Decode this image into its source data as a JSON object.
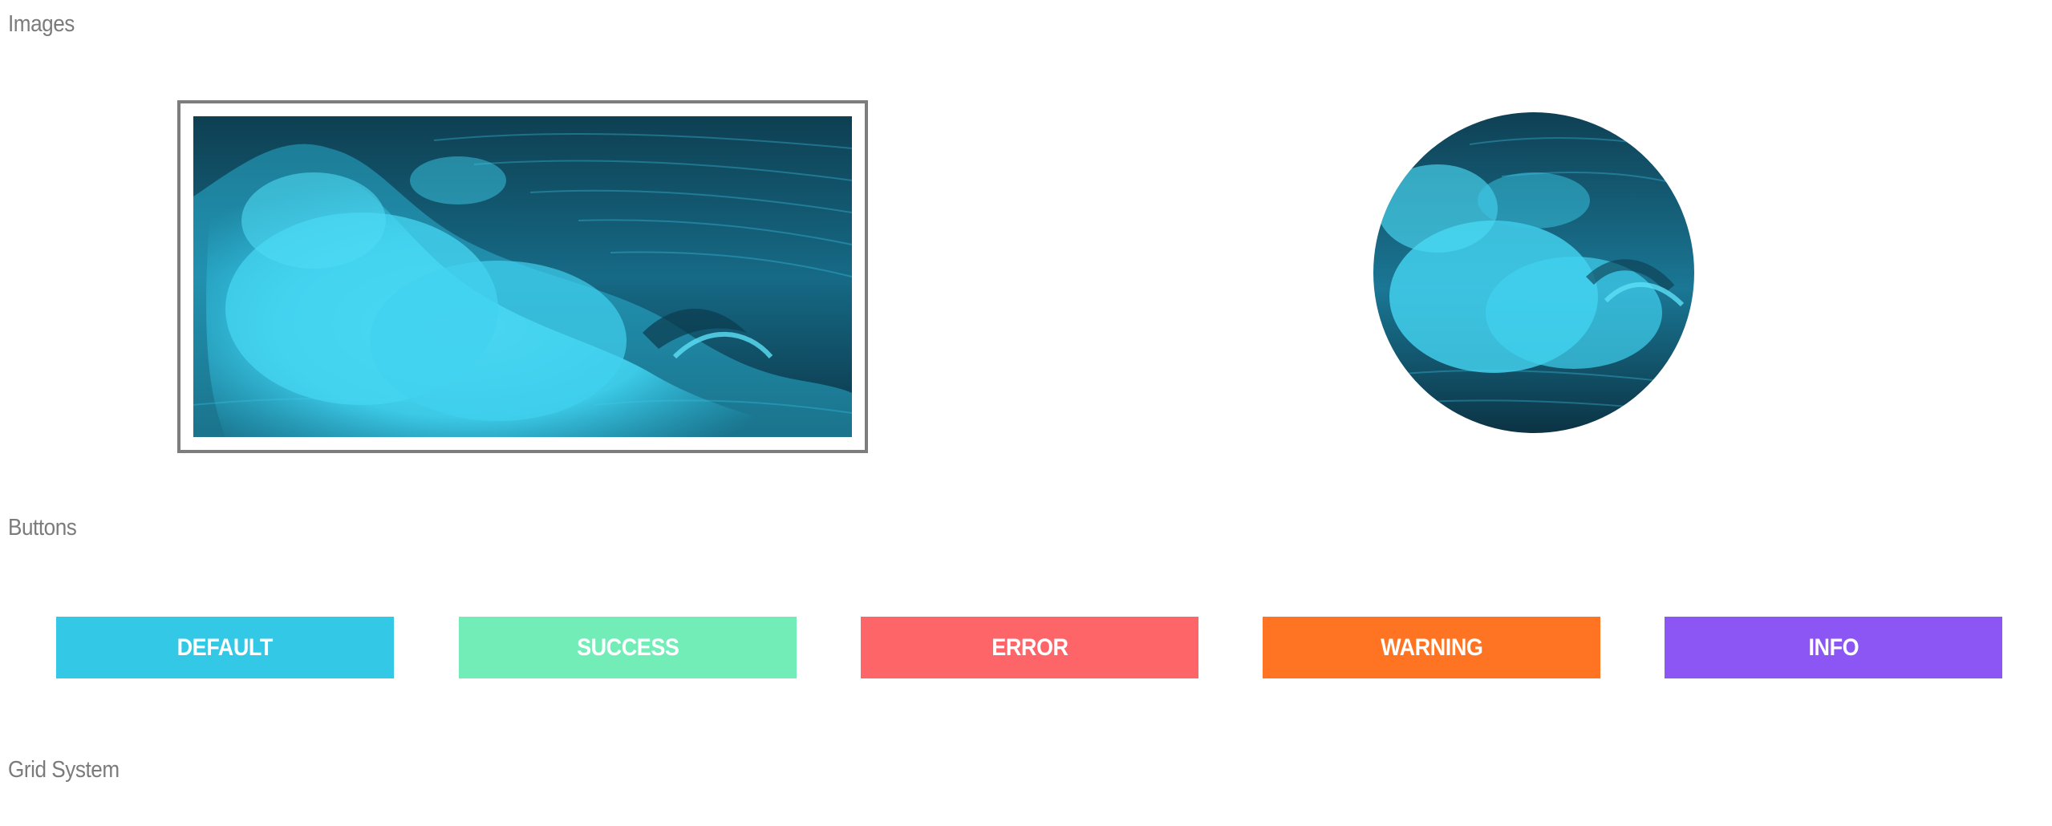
{
  "sections": {
    "images": "Images",
    "buttons": "Buttons",
    "grid": "Grid System"
  },
  "images": {
    "framed": {
      "subject": "ocean-wave",
      "tint": "#35cde9"
    },
    "circle": {
      "subject": "ocean-wave",
      "tint": "#35cde9"
    }
  },
  "buttons": [
    {
      "label": "DEFAULT",
      "color": "#32c8e6"
    },
    {
      "label": "SUCCESS",
      "color": "#72edb8"
    },
    {
      "label": "ERROR",
      "color": "#fd6568"
    },
    {
      "label": "WARNING",
      "color": "#ff7422"
    },
    {
      "label": "INFO",
      "color": "#8b56f3"
    }
  ]
}
